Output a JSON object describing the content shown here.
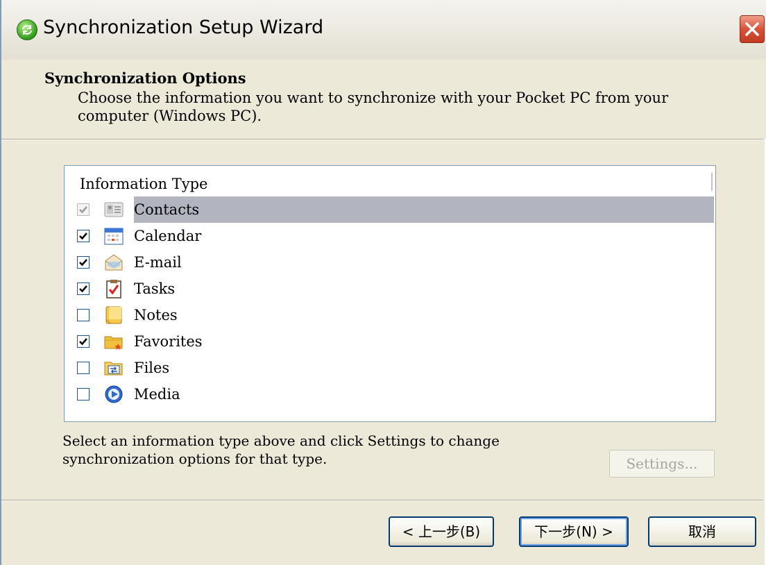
{
  "window": {
    "title": "Synchronization Setup Wizard"
  },
  "header": {
    "title": "Synchronization Options",
    "description": "Choose the information you want to synchronize with your Pocket PC from your computer (Windows PC)."
  },
  "list": {
    "column_header": "Information Type",
    "items": [
      {
        "label": "Contacts",
        "checked": true,
        "disabled": true,
        "selected": true,
        "icon": "contacts-icon"
      },
      {
        "label": "Calendar",
        "checked": true,
        "disabled": false,
        "selected": false,
        "icon": "calendar-icon"
      },
      {
        "label": "E-mail",
        "checked": true,
        "disabled": false,
        "selected": false,
        "icon": "email-icon"
      },
      {
        "label": "Tasks",
        "checked": true,
        "disabled": false,
        "selected": false,
        "icon": "tasks-icon"
      },
      {
        "label": "Notes",
        "checked": false,
        "disabled": false,
        "selected": false,
        "icon": "notes-icon"
      },
      {
        "label": "Favorites",
        "checked": true,
        "disabled": false,
        "selected": false,
        "icon": "favorites-icon"
      },
      {
        "label": "Files",
        "checked": false,
        "disabled": false,
        "selected": false,
        "icon": "files-icon"
      },
      {
        "label": "Media",
        "checked": false,
        "disabled": false,
        "selected": false,
        "icon": "media-icon"
      }
    ]
  },
  "hint": {
    "text": "Select an information type above and click Settings to change synchronization options for that type."
  },
  "buttons": {
    "settings": "Settings...",
    "back": "< 上一步(B)",
    "next": "下一步(N) >",
    "cancel": "取消"
  }
}
